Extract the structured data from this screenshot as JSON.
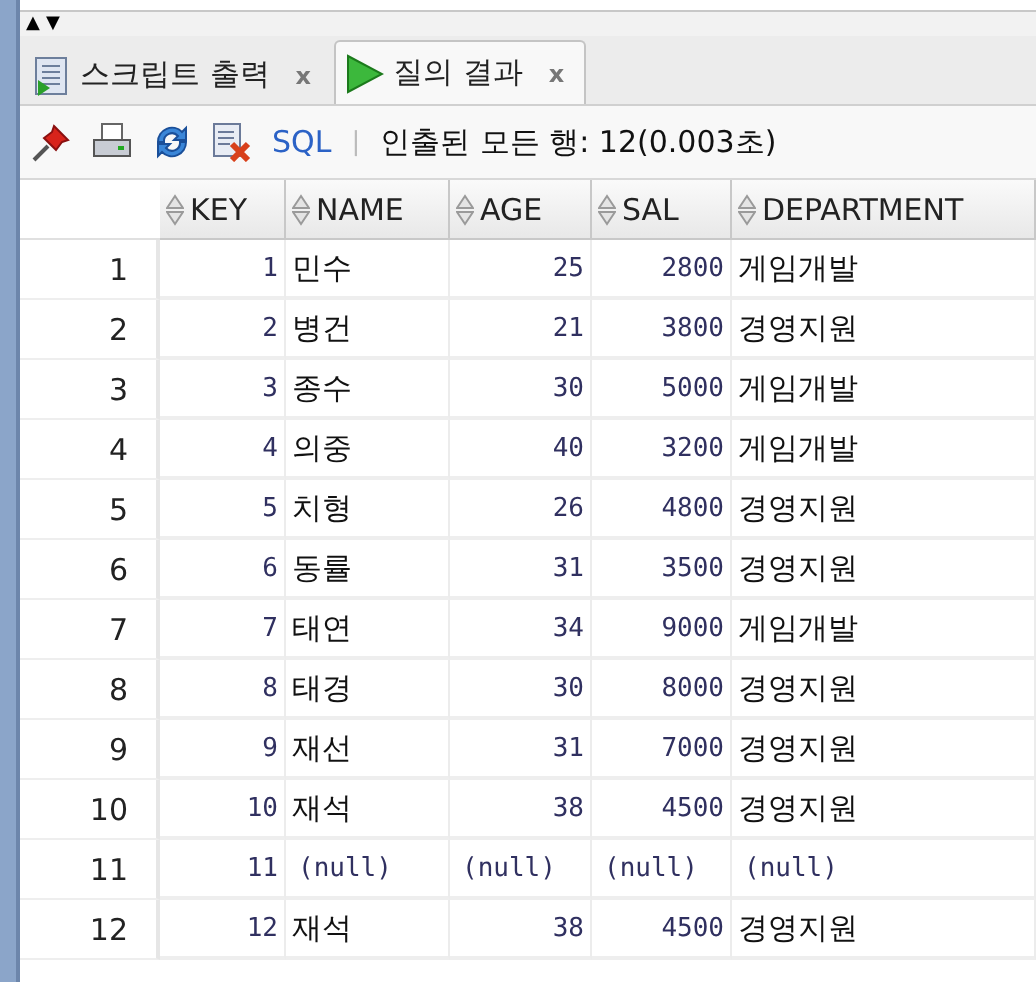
{
  "splitter_arrows": [
    "▲",
    "▼"
  ],
  "tabs": [
    {
      "label": "스크립트 출력",
      "close": "x",
      "selected": false
    },
    {
      "label": "질의 결과",
      "close": "x",
      "selected": true
    }
  ],
  "toolbar": {
    "sql_link": "SQL",
    "separator": "|",
    "status": "인출된 모든 행: 12(0.003초)"
  },
  "table": {
    "columns": [
      {
        "label": "KEY",
        "kind": "number"
      },
      {
        "label": "NAME",
        "kind": "text"
      },
      {
        "label": "AGE",
        "kind": "number"
      },
      {
        "label": "SAL",
        "kind": "number"
      },
      {
        "label": "DEPARTMENT",
        "kind": "text"
      }
    ],
    "rows": [
      {
        "number": "1",
        "cells": [
          "1",
          "민수",
          "25",
          "2800",
          "게임개발"
        ]
      },
      {
        "number": "2",
        "cells": [
          "2",
          "병건",
          "21",
          "3800",
          "경영지원"
        ]
      },
      {
        "number": "3",
        "cells": [
          "3",
          "종수",
          "30",
          "5000",
          "게임개발"
        ]
      },
      {
        "number": "4",
        "cells": [
          "4",
          "의중",
          "40",
          "3200",
          "게임개발"
        ]
      },
      {
        "number": "5",
        "cells": [
          "5",
          "치형",
          "26",
          "4800",
          "경영지원"
        ]
      },
      {
        "number": "6",
        "cells": [
          "6",
          "동률",
          "31",
          "3500",
          "경영지원"
        ]
      },
      {
        "number": "7",
        "cells": [
          "7",
          "태연",
          "34",
          "9000",
          "게임개발"
        ]
      },
      {
        "number": "8",
        "cells": [
          "8",
          "태경",
          "30",
          "8000",
          "경영지원"
        ]
      },
      {
        "number": "9",
        "cells": [
          "9",
          "재선",
          "31",
          "7000",
          "경영지원"
        ]
      },
      {
        "number": "10",
        "cells": [
          "10",
          "재석",
          "38",
          "4500",
          "경영지원"
        ]
      },
      {
        "number": "11",
        "cells": [
          "11",
          {
            "text": "(null)",
            "null": true
          },
          {
            "text": "(null)",
            "null": true
          },
          {
            "text": "(null)",
            "null": true
          },
          {
            "text": "(null)",
            "null": true
          }
        ]
      },
      {
        "number": "12",
        "cells": [
          "12",
          "재석",
          "38",
          "4500",
          "경영지원"
        ]
      }
    ]
  }
}
